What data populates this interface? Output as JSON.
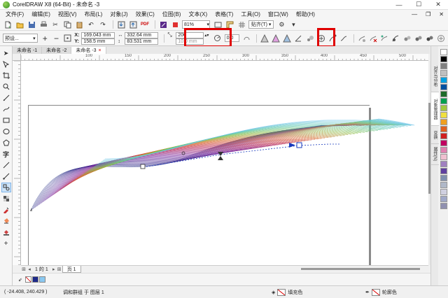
{
  "window": {
    "title": "CorelDRAW X8 (64-Bit) - 未命名 -3",
    "minimize": "—",
    "maximize": "☐",
    "close": "✕"
  },
  "menu": [
    "文件(F)",
    "编辑(E)",
    "视图(V)",
    "布局(L)",
    "对象(J)",
    "效果(C)",
    "位图(B)",
    "文本(X)",
    "表格(T)",
    "工具(O)",
    "窗口(W)",
    "帮助(H)"
  ],
  "menu_right": [
    "—",
    "❐",
    "✕"
  ],
  "toolbar": {
    "zoom": "81%",
    "snap_label": "贴齐(T)"
  },
  "propbar": {
    "preset": "预设...",
    "x_label": "X:",
    "x_value": "169.043 mm",
    "y_label": "Y:",
    "y_value": "158.5 mm",
    "w_value": "332.64 mm",
    "h_value": "83.531 mm",
    "steps_value": "200",
    "spacing_value": "10.0 mm",
    "accel_value": "0.0"
  },
  "tabs": [
    {
      "label": "未命名 -1"
    },
    {
      "label": "未命名 -2"
    },
    {
      "label": "未命名 -3",
      "active": true
    }
  ],
  "ruler": {
    "marks": [
      "",
      "100",
      "150",
      "200",
      "250",
      "300",
      "350",
      "400",
      "450",
      "500",
      "550"
    ]
  },
  "dockers": [
    "对齐与分布",
    "对象管理器",
    "变换",
    "属性(N)"
  ],
  "page_nav": {
    "current": "1",
    "of_label": "的",
    "total": "1",
    "page_tab": "页 1"
  },
  "status": {
    "coords": "( -24.408, 240.429 )",
    "object_info": "调和群组 于 图层 1",
    "fill_label": "填充色",
    "outline_label": "轮廓色"
  },
  "colors": {
    "accent": "#e00000",
    "palette": [
      "#ffffff",
      "#000000",
      "#808080",
      "#c0c0c0",
      "#00a0e0",
      "#0050a0",
      "#1e6b2a",
      "#00a050",
      "#a0c840",
      "#f0e040",
      "#f0a020",
      "#e06020",
      "#d02020",
      "#c00060",
      "#e080b0",
      "#f0c0d0",
      "#a080c0",
      "#6040a0",
      "#8090b0",
      "#b0b8c8",
      "#d0d0e0",
      "#a0a8c8",
      "#9090b0"
    ]
  }
}
